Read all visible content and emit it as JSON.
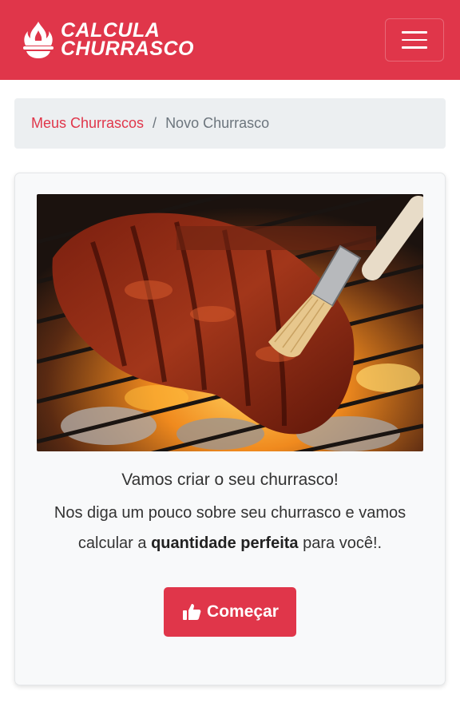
{
  "brand": {
    "line1": "CALCULA",
    "line2": "CHURRASCO",
    "logo_icon": "flame-grill-icon",
    "color": "#e0364a"
  },
  "nav": {
    "menu_icon": "hamburger-menu-icon"
  },
  "breadcrumb": {
    "items": [
      {
        "label": "Meus Churrascos"
      },
      {
        "label": "Novo Churrasco"
      }
    ],
    "separator": "/"
  },
  "card": {
    "image": "grilled-ribs-image",
    "lead": "Vamos criar o seu churrasco!",
    "text_before": "Nos diga um pouco sobre seu churrasco e vamos calcular a ",
    "text_bold": "quantidade perfeita",
    "text_after": " para você!.",
    "button_label": "Começar",
    "button_icon": "thumbs-up-icon"
  }
}
